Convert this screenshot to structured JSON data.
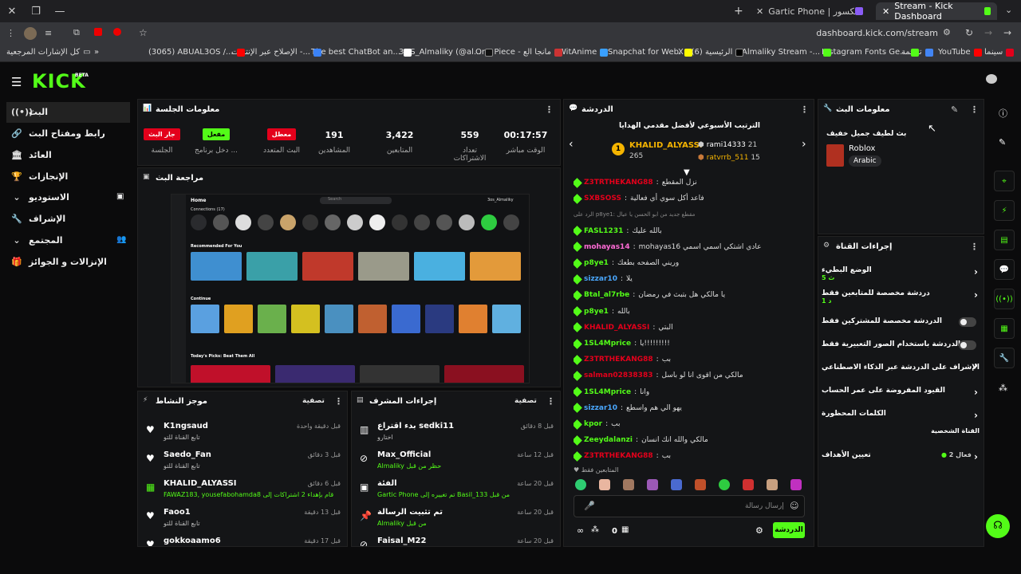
{
  "browser": {
    "tabs": [
      {
        "title": "Stream - Kick Dashboard",
        "active": true
      },
      {
        "title": "Gartic Phone | الهاتف المكسور",
        "active": false
      }
    ],
    "url": "dashboard.kick.com/stream",
    "bookmarks": [
      "سينما",
      "YouTube",
      "ترجمة",
      "Instagram Fonts Ge...",
      "Almaliky Stream -...",
      "X / الرئيسية (6)",
      "Snapchat for Web.",
      "WitAnime",
      "One Piece - مانجا الع",
      "3OS_Almaliky (@al...",
      "The best ChatBot an...",
      "الإصلاح عبر الإنترنت -...",
      "(3065) ABUAL3OS /...",
      "كل الإشارات المرجعية"
    ]
  },
  "kick": {
    "logo": "KICK",
    "logo_beta": "BETA",
    "nav": [
      {
        "label": "البث",
        "icon": "broadcast-icon"
      },
      {
        "label": "رابط ومفتاح البث",
        "icon": "link-icon"
      },
      {
        "label": "العائد",
        "icon": "bank-icon"
      },
      {
        "label": "الإنجازات",
        "icon": "trophy-icon"
      },
      {
        "label": "الاستوديو",
        "icon": "chevron-down-icon"
      },
      {
        "label": "الإشراف",
        "icon": "wrench-icon"
      },
      {
        "label": "المجتمع",
        "icon": "chevron-down-icon"
      },
      {
        "label": "الإنزالات و الجوائز",
        "icon": "gift-icon"
      }
    ]
  },
  "session": {
    "title": "معلومات الجلسة",
    "stats": [
      {
        "value": "00:17:57",
        "label": "الوقت مباشر"
      },
      {
        "value": "559",
        "label": "تعداد الاشتراكات"
      },
      {
        "value": "3,422",
        "label": "المتابعين"
      },
      {
        "value": "191",
        "label": "المشاهدين"
      }
    ],
    "badges": [
      {
        "text": "معطل",
        "label": "البث المتعدد",
        "color": "#e3001b"
      },
      {
        "text": "مفعل",
        "label": "دخل برنامج ...",
        "color": "#53fc18"
      },
      {
        "text": "جار البث",
        "label": "الجلسة",
        "color": "#e3001b"
      }
    ]
  },
  "preview": {
    "title": "مراجعة البث",
    "home": "Home",
    "search": "Search",
    "connections": "Connections (17)",
    "recommended": "Recommended For You",
    "continue": "Continue",
    "picks": "Today's Picks: Beat Them All",
    "user": "3os_Almaliky"
  },
  "activity": {
    "title": "موجز النشاط",
    "filter": "تصفية",
    "rows": [
      {
        "name": "K1ngsaud",
        "sub": "تابع القناة للتو",
        "time": "قبل دقيقة واحدة",
        "icon": "heart-icon"
      },
      {
        "name": "Saedo_Fan",
        "sub": "تابع القناة للتو",
        "time": "قبل 3 دقائق",
        "icon": "heart-icon"
      },
      {
        "name": "KHALID_ALYASSI",
        "sub": "FAWAZ183, yousefabohamda8 قام بإهداء 2 اشتراكات إلى",
        "time": "قبل 6 دقائق",
        "icon": "gift-icon"
      },
      {
        "name": "Faoo1",
        "sub": "تابع القناة للتو",
        "time": "قبل 13 دقيقة",
        "icon": "heart-icon"
      },
      {
        "name": "gokkoaamo6",
        "sub": "",
        "time": "قبل 17 دقيقة",
        "icon": "heart-icon"
      }
    ]
  },
  "modactions": {
    "title": "إجراءات المشرف",
    "filter": "تصفية",
    "rows": [
      {
        "name": "بدء اقتراع sedki11",
        "sub": "اختارو",
        "time": "قبل 8 دقائق",
        "icon": "poll-icon"
      },
      {
        "name": "Max_Official",
        "sub": "Almaliky حظر من قبل",
        "time": "قبل 12 ساعة",
        "icon": "ban-icon"
      },
      {
        "name": "الفئة",
        "sub": "Gartic Phone تم تغييره إلى Basil_133 من قبل",
        "time": "قبل 20 ساعة",
        "icon": "category-icon"
      },
      {
        "name": "تم تثبيت الرسالة",
        "sub": "Almaliky من قبل",
        "time": "قبل 20 ساعة",
        "icon": "pin-icon"
      },
      {
        "name": "Faisal_M22",
        "sub": "",
        "time": "قبل 20 ساعة",
        "icon": "ban-icon"
      }
    ]
  },
  "chat": {
    "title": "الدردشة",
    "leaderboard_title": "الترتيب الأسبوعي لأفضل مقدمي الهدايا",
    "leaders": [
      {
        "name": "KHALID_ALYASSI",
        "count": "265",
        "rank": "1"
      },
      {
        "name": "rami14333",
        "count": "21"
      },
      {
        "name": "ratvrrb_511",
        "count": "15"
      }
    ],
    "messages": [
      {
        "user": "Z3TRTHEKANG88",
        "color": "#e3001b",
        "text": "نزل المقطع"
      },
      {
        "user": "SXBSOSS",
        "color": "#e3001b",
        "text": "فاعد أكل سوي أي فعالية"
      },
      {
        "user": "",
        "color": "#888",
        "text": "الرد على p8ye1: مقطع جديد من ابو الحسن يا عيال"
      },
      {
        "user": "FASL1231",
        "color": "#53fc18",
        "text": "بالله عليك"
      },
      {
        "user": "mohayas14",
        "color": "#ff6bd6",
        "text": "mohayas16 عادي اشتكي اسمي اسمي"
      },
      {
        "user": "p8ye1",
        "color": "#53fc18",
        "text": "وريني الصفحه بطعك"
      },
      {
        "user": "sizzar10",
        "color": "#4aa8ff",
        "text": "يلا"
      },
      {
        "user": "Btal_al7rbe",
        "color": "#53fc18",
        "text": "يا مالكي هل بتبث في رمضان"
      },
      {
        "user": "p8ye1",
        "color": "#53fc18",
        "text": "بالله"
      },
      {
        "user": "KHALID_ALYASSI",
        "color": "#e3001b",
        "text": "البتي"
      },
      {
        "user": "1SL4Mprice",
        "color": "#53fc18",
        "text": "يا!!!!!!!!!"
      },
      {
        "user": "Z3TRTHEKANG88",
        "color": "#e3001b",
        "text": "بب"
      },
      {
        "user": "salman02838383",
        "color": "#e3001b",
        "text": "مالكي من اقوى انا لو باسل"
      },
      {
        "user": "1SL4Mprice",
        "color": "#53fc18",
        "text": "وانا"
      },
      {
        "user": "sizzar10",
        "color": "#4aa8ff",
        "text": "يهو الي هم واسطع"
      },
      {
        "user": "kpor",
        "color": "#53fc18",
        "text": "بب"
      },
      {
        "user": "Zeeydalanzi",
        "color": "#53fc18",
        "text": "مالكي والله انك انسان"
      },
      {
        "user": "Z3TRTHEKANG88",
        "color": "#e3001b",
        "text": "بب"
      }
    ],
    "followers_only": "المتابعين فقط",
    "input_placeholder": "إرسال رسالة",
    "send_label": "الدردشة",
    "points": "0"
  },
  "streaminfo": {
    "title": "معلومات البث",
    "stream_title": "بث لطيف جميل خفيف",
    "category": "Roblox",
    "language": "Arabic"
  },
  "channelactions": {
    "title": "إجراءات القناة",
    "items": [
      {
        "label": "الوضع البطيء",
        "sub": "5 ث",
        "control": "chevron"
      },
      {
        "label": "دردشة مخصصة للمتابعين فقط",
        "sub": "1 د",
        "control": "chevron"
      },
      {
        "label": "الدردشة مخصصة للمشتركين فقط",
        "sub": "",
        "control": "toggle"
      },
      {
        "label": "الدردشة باستخدام الصور التعبيرية فقط",
        "sub": "",
        "control": "toggle"
      },
      {
        "label": "الإشراف على الدردشة عبر الذكاء الاصطناعي",
        "sub": "",
        "control": "external"
      },
      {
        "label": "القيود المفروضة على عمر الحساب",
        "sub": "",
        "control": "chevron"
      },
      {
        "label": "الكلمات المحظورة",
        "sub": "",
        "control": "chevron"
      }
    ],
    "section": "القناة الشخصية",
    "goals_label": "تعيين الأهداف",
    "goals_value": "فعال 2"
  }
}
